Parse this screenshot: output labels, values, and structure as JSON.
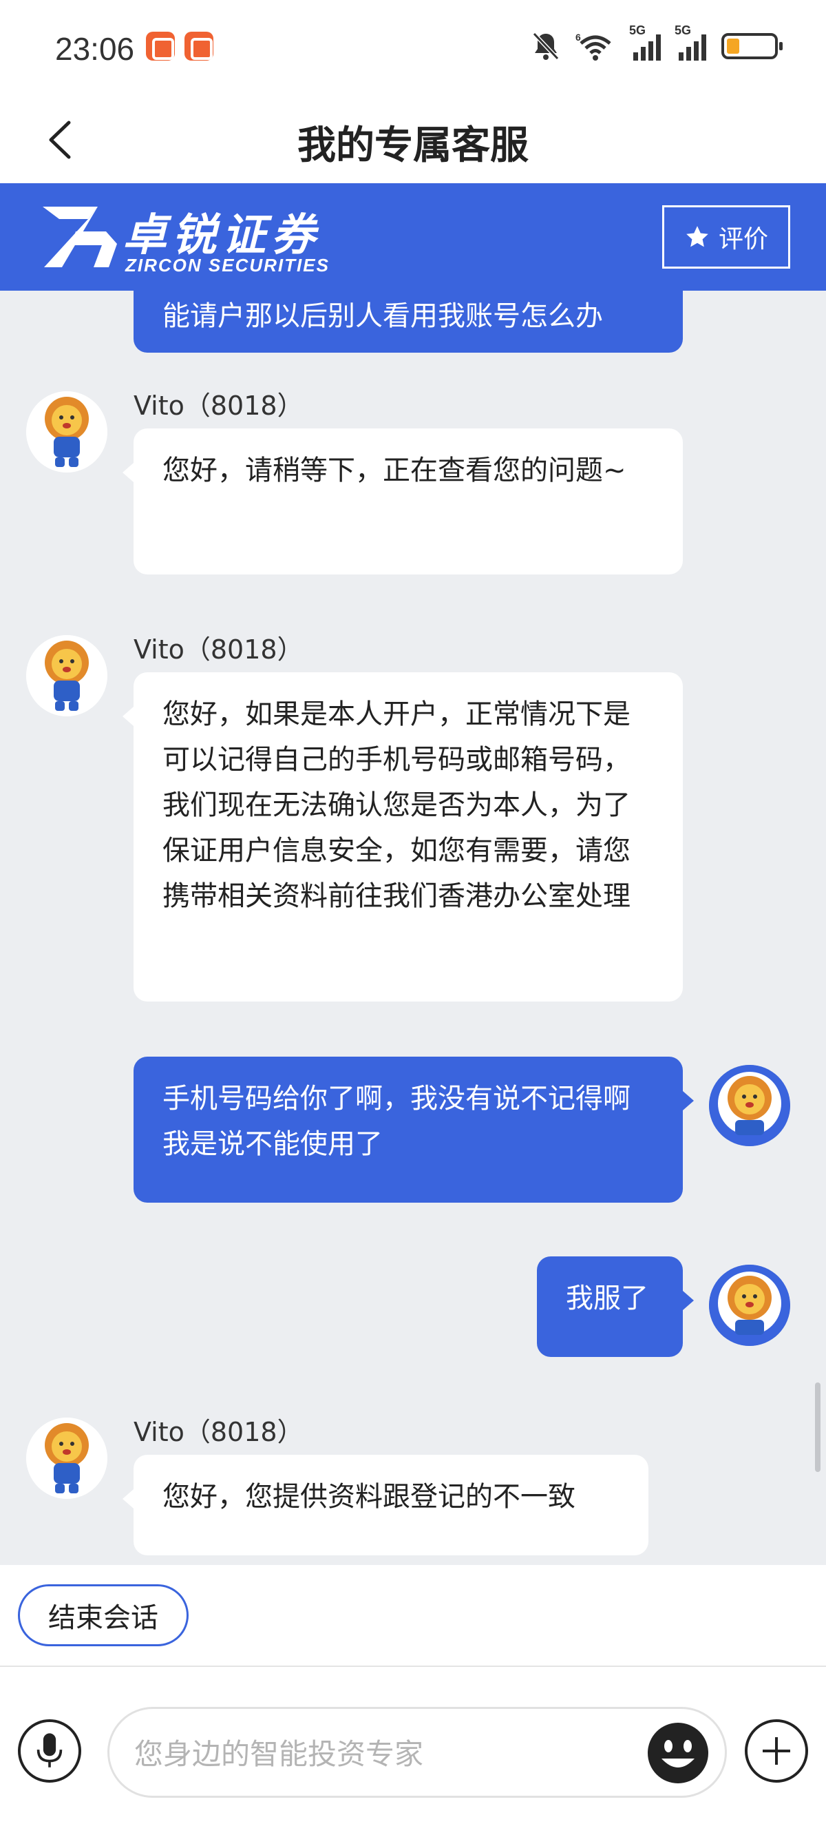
{
  "status_bar": {
    "time": "23:06",
    "network_1": "5G",
    "network_2": "5G",
    "battery_level": 0.2
  },
  "header": {
    "title": "我的专属客服"
  },
  "banner": {
    "brand_cn": "卓锐证券",
    "brand_en": "ZIRCON SECURITIES",
    "rate_label": "评价",
    "brand_color": "#3a64dd"
  },
  "chat": {
    "partial_user_message": "能请户那以后别人看用我账号怎么办",
    "messages": [
      {
        "from": "agent",
        "sender": "Vito（8018）",
        "text": "您好，请稍等下，正在查看您的问题~"
      },
      {
        "from": "agent",
        "sender": "Vito（8018）",
        "text": "您好，如果是本人开户，正常情况下是可以记得自己的手机号码或邮箱号码，我们现在无法确认您是否为本人，为了保证用户信息安全，如您有需要，请您携带相关资料前往我们香港办公室处理"
      },
      {
        "from": "user",
        "text": "手机号码给你了啊，我没有说不记得啊我是说不能使用了"
      },
      {
        "from": "user",
        "text": "我服了"
      },
      {
        "from": "agent",
        "sender": "Vito（8018）",
        "text": "您好，您提供资料跟登记的不一致"
      }
    ]
  },
  "quick_actions": {
    "end_session": "结束会话"
  },
  "input": {
    "placeholder": "您身边的智能投资专家",
    "voice_icon": "microphone-icon",
    "emoji_icon": "smiley-icon",
    "add_icon": "plus-icon"
  }
}
